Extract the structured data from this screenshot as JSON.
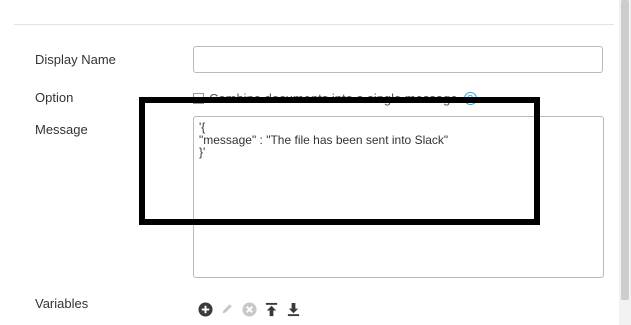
{
  "form": {
    "display_name_label": "Display Name",
    "display_name_value": "",
    "option_label": "Option",
    "option_checkbox_label": "Combine documents into a single message",
    "option_checked": false,
    "message_label": "Message",
    "message_value": "'{\n\"message\" : \"The file has been sent into Slack\"\n}'",
    "variables_label": "Variables"
  },
  "icons": {
    "help": "question-circle-icon",
    "add": "plus-circle-icon",
    "edit": "pencil-icon",
    "remove": "x-circle-icon",
    "move_top": "move-to-top-icon",
    "move_bottom": "move-to-bottom-icon"
  },
  "colors": {
    "highlight_border": "#000000",
    "help_icon": "#38a1dc",
    "icon_dark": "#3a3a3a",
    "icon_disabled": "#c8c8c8"
  }
}
